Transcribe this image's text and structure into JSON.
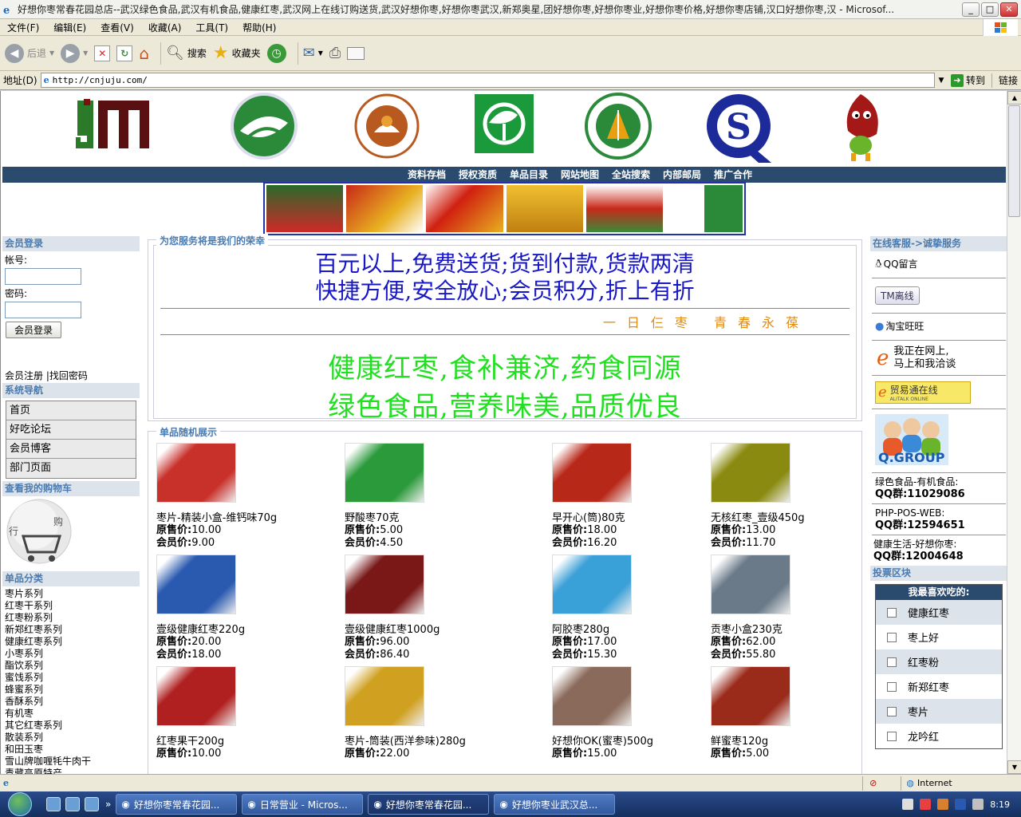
{
  "window": {
    "title": "好想你枣常春花园总店--武汉绿色食品,武汉有机食品,健康红枣,武汉网上在线订购送货,武汉好想你枣,好想你枣武汉,新郑奥星,团好想你枣,好想你枣业,好想你枣价格,好想你枣店铺,汉口好想你枣,汉 - Microsof..."
  },
  "menu": [
    "文件(F)",
    "编辑(E)",
    "查看(V)",
    "收藏(A)",
    "工具(T)",
    "帮助(H)"
  ],
  "toolbar": {
    "back": "后退",
    "search": "搜索",
    "favorites": "收藏夹"
  },
  "address": {
    "label": "地址(D)",
    "url": "http://cnjuju.com/",
    "go": "转到",
    "links": "链接"
  },
  "nav": [
    "资料存档",
    "授权资质",
    "单品目录",
    "网站地图",
    "全站搜索",
    "内部邮局",
    "推广合作"
  ],
  "left": {
    "login_title": "会员登录",
    "account_label": "帐号:",
    "password_label": "密码:",
    "login_button": "会员登录",
    "register": "会员注册",
    "forgot": "|找回密码",
    "nav_title": "系统导航",
    "nav_items": [
      "首页",
      "好吃论坛",
      "会员博客",
      "部门页面"
    ],
    "cart_title": "查看我的购物车",
    "cat_title": "单品分类",
    "categories": [
      "枣片系列",
      "红枣干系列",
      "红枣粉系列",
      "新郑红枣系列",
      "健康红枣系列",
      "小枣系列",
      "酯饮系列",
      "蜜饯系列",
      "蜂蜜系列",
      "香酥系列",
      "有机枣",
      "其它红枣系列",
      "散装系列",
      "和田玉枣",
      "雪山牌咖喱牦牛肉干",
      "青藏高原特产"
    ]
  },
  "center": {
    "service_title": "为您服务将是我们的荣幸",
    "slogan1a": "百元以上,免费送货;货到付款,货款两清",
    "slogan1b": "快捷方便,安全放心;会员积分,折上有折",
    "motto": "一日仨枣 青春永葆",
    "slogan2a": "健康红枣,食补兼济,药食同源",
    "slogan2b": "绿色食品,营养味美,品质优良",
    "products_title": "单品随机展示",
    "orig_label": "原售价:",
    "member_label": "会员价:",
    "products": [
      {
        "name": "枣片-精装小盒-维钙味70g",
        "orig": "10.00",
        "member": "9.00",
        "color": "#c8302a"
      },
      {
        "name": "野酸枣70克",
        "orig": "5.00",
        "member": "4.50",
        "color": "#2a9a3a"
      },
      {
        "name": "早开心(筒)80克",
        "orig": "18.00",
        "member": "16.20",
        "color": "#b82818"
      },
      {
        "name": "无核红枣_壹级450g",
        "orig": "13.00",
        "member": "11.70",
        "color": "#8a8a10"
      },
      {
        "name": "壹级健康红枣220g",
        "orig": "20.00",
        "member": "18.00",
        "color": "#2a5ab0"
      },
      {
        "name": "壹级健康红枣1000g",
        "orig": "96.00",
        "member": "86.40",
        "color": "#7a1818"
      },
      {
        "name": "阿胶枣280g",
        "orig": "17.00",
        "member": "15.30",
        "color": "#3aa0d8"
      },
      {
        "name": "贡枣小盒230克",
        "orig": "62.00",
        "member": "55.80",
        "color": "#6a7a88"
      },
      {
        "name": "红枣果干200g",
        "orig": "10.00",
        "member": "",
        "color": "#b02020"
      },
      {
        "name": "枣片-筒装(西洋参味)280g",
        "orig": "22.00",
        "member": "",
        "color": "#d0a020"
      },
      {
        "name": "好想你OK(蜜枣)500g",
        "orig": "15.00",
        "member": "",
        "color": "#8a6a5a"
      },
      {
        "name": "鲜蜜枣120g",
        "orig": "5.00",
        "member": "",
        "color": "#9a2a1a"
      }
    ]
  },
  "right": {
    "service_title": "在线客服->诚挚服务",
    "qq_msg": "QQ留言",
    "tm": "TM离线",
    "wangwang": "淘宝旺旺",
    "chat1": "我正在网上,",
    "chat2": "马上和我洽谈",
    "alitalk": "贸易通在线",
    "alitalk_sub": "ALITALK ONLINE",
    "groups": [
      {
        "name": "绿色食品-有机食品:",
        "qq": "QQ群:11029086"
      },
      {
        "name": "PHP-POS-WEB:",
        "qq": "QQ群:12594651"
      },
      {
        "name": "健康生活-好想你枣:",
        "qq": "QQ群:12004648"
      }
    ],
    "vote_title": "投票区块",
    "vote_question": "我最喜欢吃的:",
    "vote_options": [
      "健康红枣",
      "枣上好",
      "红枣粉",
      "新郑红枣",
      "枣片",
      "龙吟红"
    ]
  },
  "status": {
    "zone": "Internet"
  },
  "taskbar": {
    "tasks": [
      "好想你枣常春花园...",
      "日常营业 - Micros...",
      "好想你枣常春花园...",
      "好想你枣业武汉总..."
    ],
    "time": "8:19"
  }
}
